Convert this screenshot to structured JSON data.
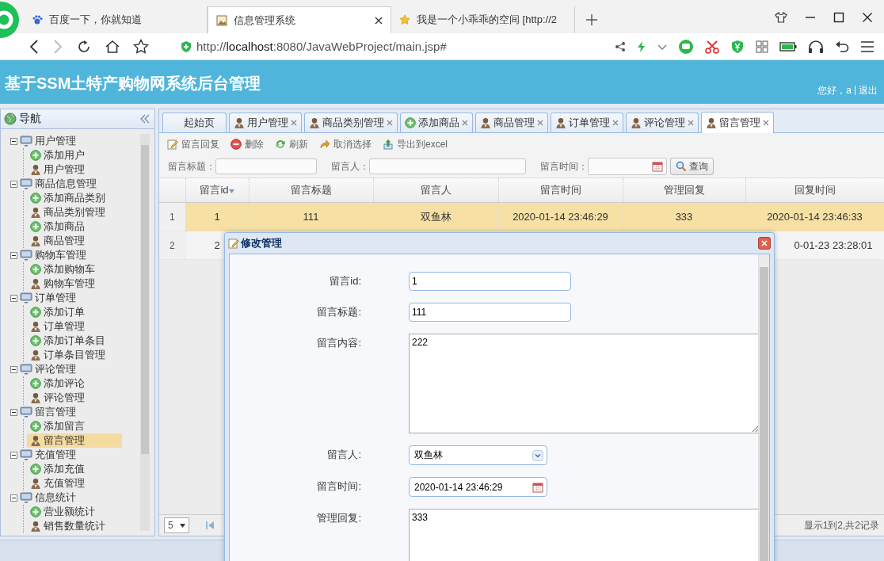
{
  "browser": {
    "tabs": [
      {
        "title": "百度一下，你就知道",
        "kind": "paw",
        "selected": false
      },
      {
        "title": "信息管理系统",
        "kind": "page",
        "selected": true
      },
      {
        "title": "我是一个小乖乖的空间 [http://2",
        "kind": "star",
        "selected": false
      }
    ],
    "address": "http://**localhost**:8080/JavaWebProject/main.jsp#"
  },
  "header": {
    "title": "基于SSM土特产购物网系统后台管理",
    "greeting": "您好，a",
    "separator": "|",
    "logout": "退出"
  },
  "sidebar": {
    "title": "导航",
    "tree": [
      {
        "label": "用户管理",
        "expanded": true,
        "children": [
          {
            "label": "添加用户",
            "kind": "add",
            "selected": false
          },
          {
            "label": "用户管理",
            "kind": "user",
            "selected": false
          }
        ]
      },
      {
        "label": "商品信息管理",
        "expanded": true,
        "children": [
          {
            "label": "添加商品类别",
            "kind": "add",
            "selected": false
          },
          {
            "label": "商品类别管理",
            "kind": "user",
            "selected": false
          },
          {
            "label": "添加商品",
            "kind": "add",
            "selected": false
          },
          {
            "label": "商品管理",
            "kind": "user",
            "selected": false
          }
        ]
      },
      {
        "label": "购物车管理",
        "expanded": true,
        "children": [
          {
            "label": "添加购物车",
            "kind": "add",
            "selected": false
          },
          {
            "label": "购物车管理",
            "kind": "user",
            "selected": false
          }
        ]
      },
      {
        "label": "订单管理",
        "expanded": true,
        "children": [
          {
            "label": "添加订单",
            "kind": "add",
            "selected": false
          },
          {
            "label": "订单管理",
            "kind": "user",
            "selected": false
          },
          {
            "label": "添加订单条目",
            "kind": "add",
            "selected": false
          },
          {
            "label": "订单条目管理",
            "kind": "user",
            "selected": false
          }
        ]
      },
      {
        "label": "评论管理",
        "expanded": true,
        "children": [
          {
            "label": "添加评论",
            "kind": "add",
            "selected": false
          },
          {
            "label": "评论管理",
            "kind": "user",
            "selected": false
          }
        ]
      },
      {
        "label": "留言管理",
        "expanded": true,
        "children": [
          {
            "label": "添加留言",
            "kind": "add",
            "selected": false
          },
          {
            "label": "留言管理",
            "kind": "user",
            "selected": true
          }
        ]
      },
      {
        "label": "充值管理",
        "expanded": true,
        "children": [
          {
            "label": "添加充值",
            "kind": "add",
            "selected": false
          },
          {
            "label": "充值管理",
            "kind": "user",
            "selected": false
          }
        ]
      },
      {
        "label": "信息统计",
        "expanded": true,
        "children": [
          {
            "label": "营业额统计",
            "kind": "add",
            "selected": false
          },
          {
            "label": "销售数量统计",
            "kind": "user",
            "selected": false
          }
        ]
      }
    ]
  },
  "tabs": [
    {
      "label": "起始页",
      "kind": "home",
      "closable": false,
      "selected": false
    },
    {
      "label": "用户管理",
      "kind": "user",
      "closable": true,
      "selected": false
    },
    {
      "label": "商品类别管理",
      "kind": "user",
      "closable": true,
      "selected": false
    },
    {
      "label": "添加商品",
      "kind": "add",
      "closable": true,
      "selected": false
    },
    {
      "label": "商品管理",
      "kind": "user",
      "closable": true,
      "selected": false
    },
    {
      "label": "订单管理",
      "kind": "user",
      "closable": true,
      "selected": false
    },
    {
      "label": "评论管理",
      "kind": "user",
      "closable": true,
      "selected": false
    },
    {
      "label": "留言管理",
      "kind": "user",
      "closable": true,
      "selected": true
    }
  ],
  "toolbar": [
    {
      "label": "留言回复",
      "kind": "edit"
    },
    {
      "label": "删除",
      "kind": "delete"
    },
    {
      "label": "刷新",
      "kind": "refresh"
    },
    {
      "label": "取消选择",
      "kind": "undo"
    },
    {
      "label": "导出到excel",
      "kind": "export"
    }
  ],
  "search": {
    "fields": [
      {
        "label": "留言标题：",
        "kind": "text"
      },
      {
        "label": "留言人：",
        "kind": "text"
      },
      {
        "label": "留言时间：",
        "kind": "date"
      }
    ],
    "button": "查询"
  },
  "table": {
    "columns": [
      {
        "label": "留言id",
        "sorted": true
      },
      {
        "label": "留言标题",
        "sorted": false
      },
      {
        "label": "留言人",
        "sorted": false
      },
      {
        "label": "留言时间",
        "sorted": false
      },
      {
        "label": "管理回复",
        "sorted": false
      },
      {
        "label": "回复时间",
        "sorted": false
      }
    ],
    "rows": [
      {
        "number": "1",
        "selected": true,
        "cells": [
          "1",
          "111",
          "双鱼林",
          "2020-01-14 23:46:29",
          "333",
          "2020-01-14 23:46:33"
        ]
      },
      {
        "number": "2",
        "selected": false,
        "cells": [
          "2",
          null,
          null,
          null,
          null,
          "0-01-23 23:28:01"
        ]
      }
    ]
  },
  "pager": {
    "page_size": "5",
    "summary": "显示1到2,共2记录"
  },
  "dialog": {
    "title": "修改管理",
    "fields": [
      {
        "label": "留言id:",
        "kind": "text",
        "value": "1"
      },
      {
        "label": "留言标题:",
        "kind": "text",
        "value": "111"
      },
      {
        "label": "留言内容:",
        "kind": "textarea",
        "value": "222"
      },
      {
        "label": "留言人:",
        "kind": "select",
        "value": "双鱼林"
      },
      {
        "label": "留言时间:",
        "kind": "date",
        "value": "2020-01-14 23:46:29"
      },
      {
        "label": "管理回复:",
        "kind": "textarea",
        "value": "333"
      }
    ]
  }
}
